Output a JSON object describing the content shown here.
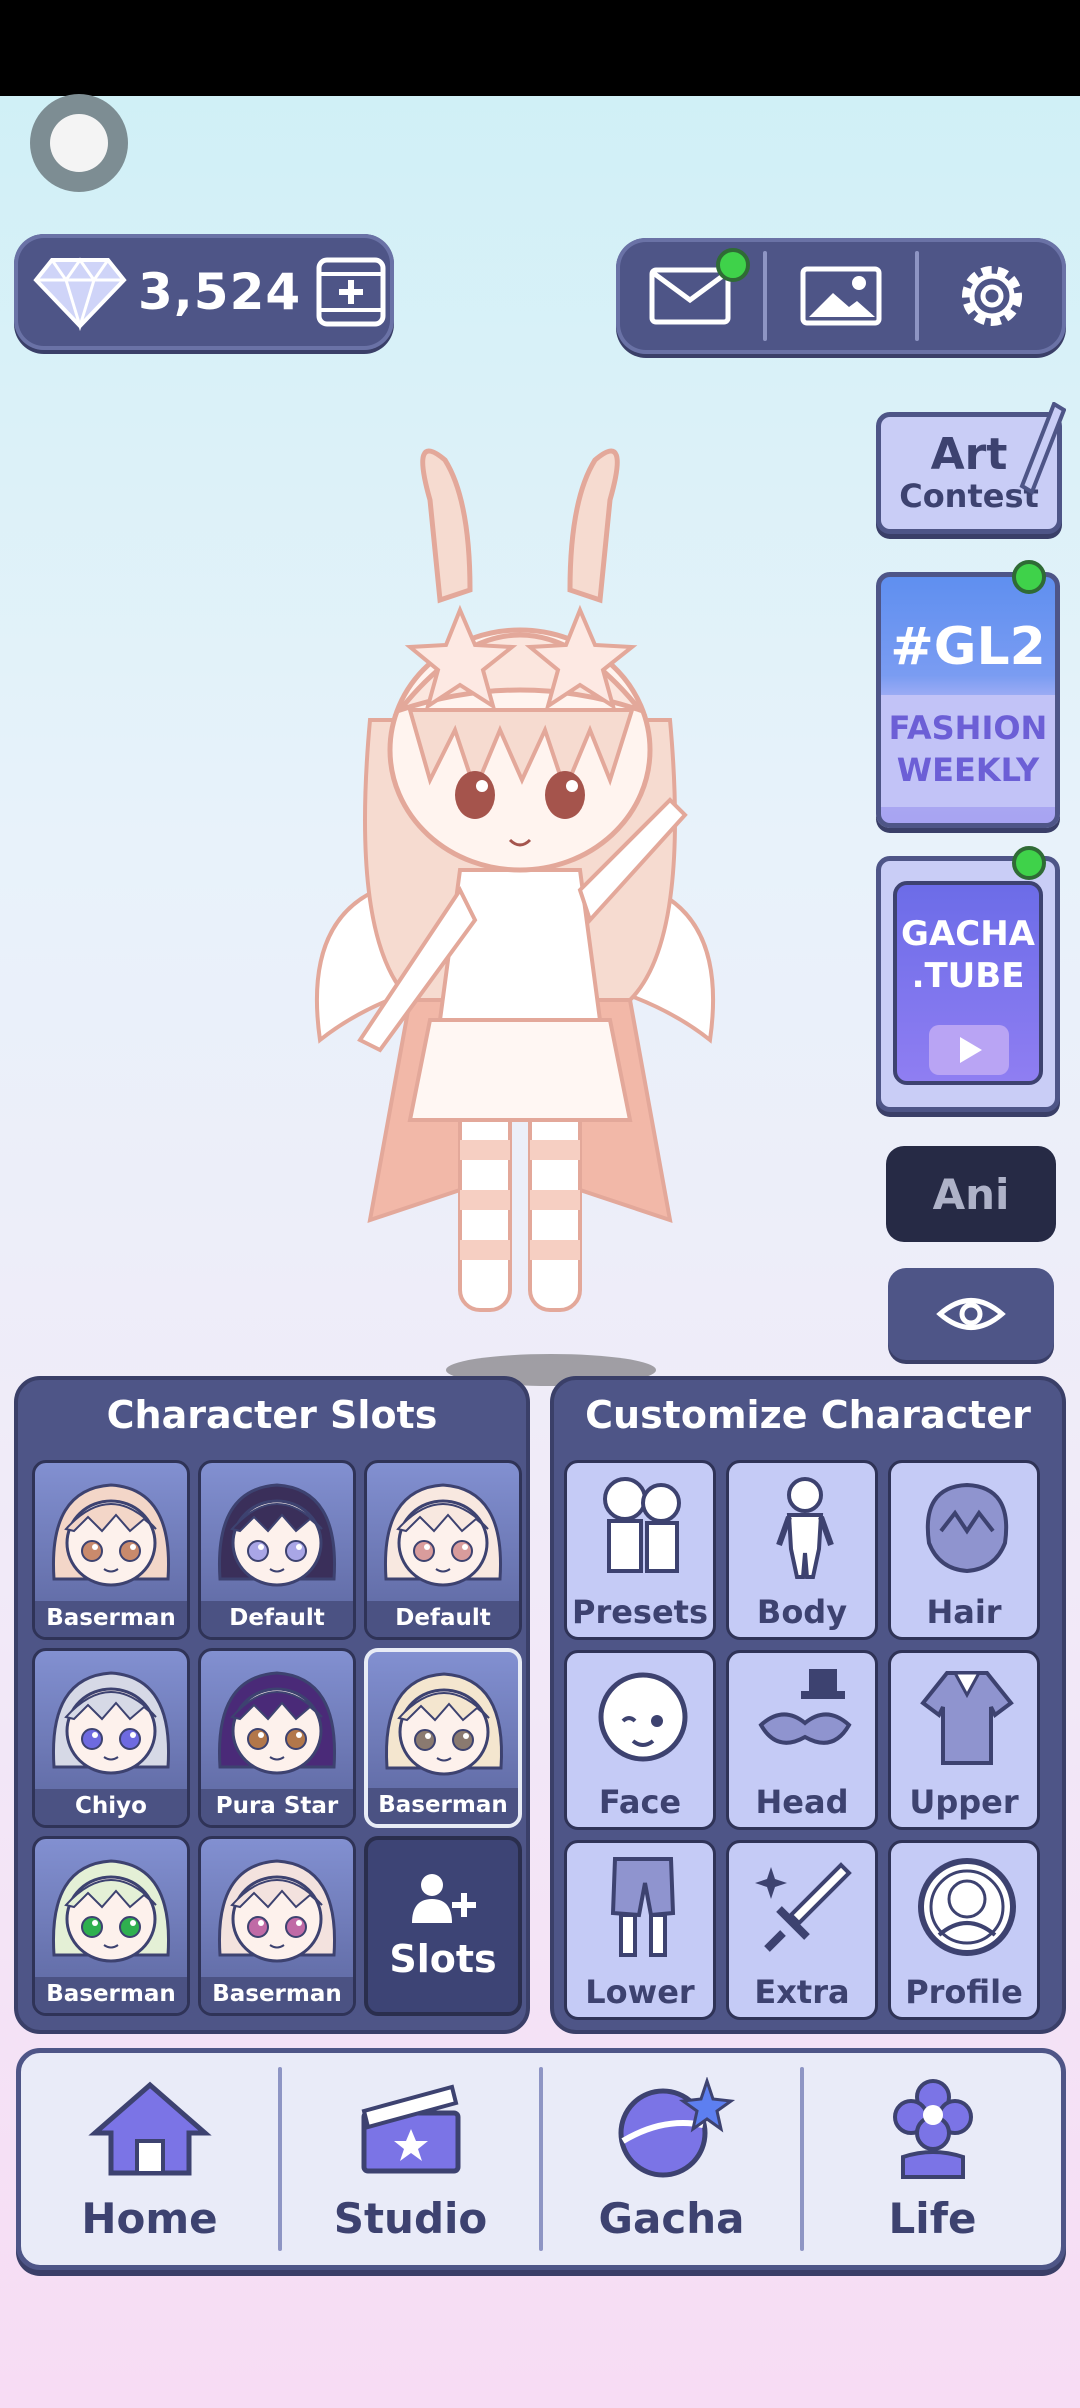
{
  "currency": {
    "gems": "3,524"
  },
  "toolbar": {
    "mail_icon": "mail-icon",
    "gallery_icon": "image-icon",
    "settings_icon": "gear-icon"
  },
  "side": {
    "art_contest": [
      "Art",
      "Contest"
    ],
    "gl2": {
      "title": "#GL2",
      "line1": "FASHION",
      "line2": "WEEKLY"
    },
    "gacha_tube": [
      "GACHA",
      ".TUBE"
    ],
    "ani": "Ani"
  },
  "slots_panel": {
    "title": "Character Slots",
    "slots": [
      {
        "name": "Baserman",
        "hair": "#f3d6c8",
        "eye": "#c98a6c"
      },
      {
        "name": "Default Doll",
        "hair": "#3a2f5a",
        "eye": "#a9a6e6"
      },
      {
        "name": "Default Doll",
        "hair": "#f8e8e0",
        "eye": "#d99c9c"
      },
      {
        "name": "Chiyo",
        "hair": "#d6d9e6",
        "eye": "#6e6ae0"
      },
      {
        "name": "Pura Star",
        "hair": "#4a2a78",
        "eye": "#b2774a"
      },
      {
        "name": "Baserman",
        "hair": "#f4e6cf",
        "eye": "#8a7a70"
      },
      {
        "name": "Baserman",
        "hair": "#e4f0d6",
        "eye": "#2fb04f"
      },
      {
        "name": "Baserman",
        "hair": "#f3e2de",
        "eye": "#c06aa6"
      }
    ],
    "add_label": "Slots"
  },
  "customize_panel": {
    "title": "Customize Character",
    "items": [
      "Presets",
      "Body",
      "Hair",
      "Face",
      "Head",
      "Upper",
      "Lower",
      "Extra",
      "Profile"
    ]
  },
  "nav": [
    "Home",
    "Studio",
    "Gacha",
    "Life"
  ],
  "colors": {
    "panel": "#4e5587",
    "accent_green": "#3fd24a",
    "card": "#c5cbf6"
  }
}
